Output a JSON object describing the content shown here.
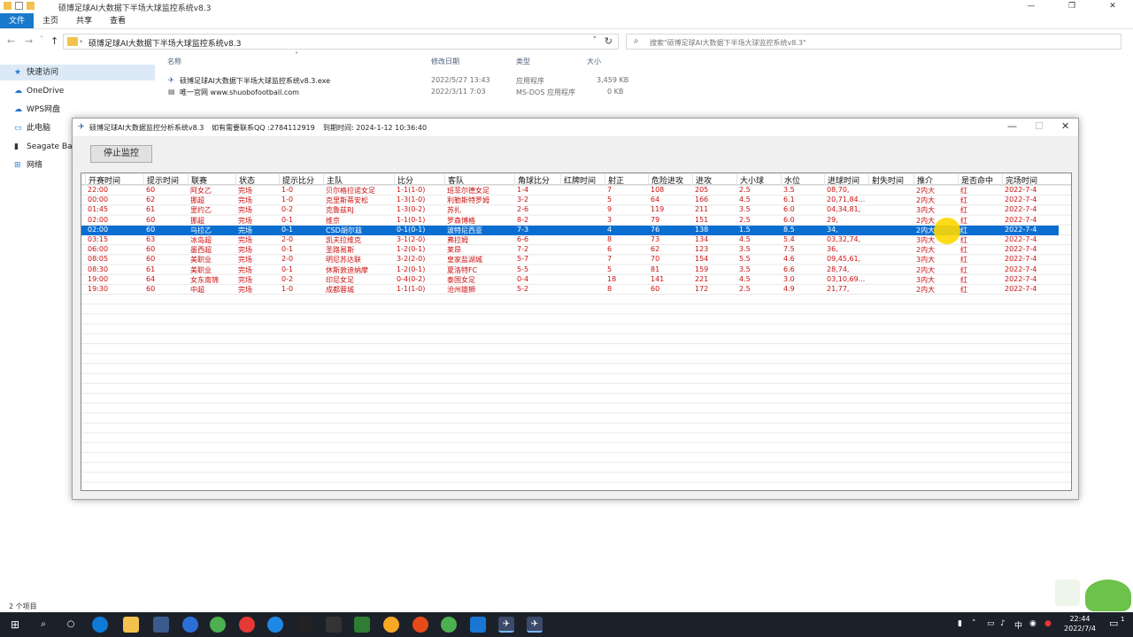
{
  "explorer": {
    "title": "硕博足球AI大数据下半场大球监控系统v8.3",
    "ribbon_tabs": [
      "文件",
      "主页",
      "共享",
      "查看"
    ],
    "breadcrumb": "硕博足球AI大数据下半场大球监控系统v8.3",
    "search_placeholder": "搜索\"硕博足球AI大数据下半场大球监控系统v8.3\"",
    "nav_items": [
      {
        "label": "快速访问",
        "icon": "star-icon"
      },
      {
        "label": "OneDrive",
        "icon": "cloud-icon"
      },
      {
        "label": "WPS网盘",
        "icon": "cloud-icon"
      },
      {
        "label": "此电脑",
        "icon": "computer-icon"
      },
      {
        "label": "Seagate Back",
        "icon": "drive-icon"
      },
      {
        "label": "网络",
        "icon": "network-icon"
      }
    ],
    "columns": [
      "名称",
      "修改日期",
      "类型",
      "大小"
    ],
    "files": [
      {
        "name": "硕博足球AI大数据下半场大球监控系统v8.3.exe",
        "date": "2022/5/27 13:43",
        "type": "应用程序",
        "size": "3,459 KB"
      },
      {
        "name": "唯一官网      www.shuobofootball.com",
        "date": "2022/3/11 7:03",
        "type": "MS-DOS 应用程序",
        "size": "0 KB"
      }
    ],
    "status": "2 个项目"
  },
  "app": {
    "title": "硕博足球AI大数据监控分析系统v8.3",
    "contact": "如有需要联系QQ :2784112919",
    "expire": "到期时间:  2024-1-12 10:36:40",
    "stop_button": "停止监控",
    "columns": [
      "开赛时间",
      "提示时间",
      "联赛",
      "状态",
      "提示比分",
      "主队",
      "比分",
      "客队",
      "角球比分",
      "红牌时间",
      "射正",
      "危险进攻",
      "进攻",
      "大小球",
      "水位",
      "进球时间",
      "射失时间",
      "推介",
      "是否命中",
      "完场时间"
    ],
    "selected_row": 3,
    "rows": [
      [
        "22:00",
        "60",
        "阿女乙",
        "完场",
        "1-0",
        "贝尔格拉诺女足",
        "1-1(1-0)",
        "班菲尔德女足",
        "1-4",
        "",
        "7",
        "108",
        "205",
        "2.5",
        "3.5",
        "08,70,",
        "",
        "2内大",
        "红",
        "2022-7-4"
      ],
      [
        "00:00",
        "62",
        "挪超",
        "完场",
        "1-0",
        "克里斯蒂安松",
        "1-3(1-0)",
        "利勒斯特罗姆",
        "3-2",
        "",
        "5",
        "64",
        "166",
        "4.5",
        "6.1",
        "20,71,84...",
        "",
        "2内大",
        "红",
        "2022-7-4"
      ],
      [
        "01:45",
        "61",
        "里约乙",
        "完场",
        "0-2",
        "克鲁兹RJ",
        "1-3(0-2)",
        "苏扎",
        "2-6",
        "",
        "9",
        "119",
        "211",
        "3.5",
        "6.0",
        "04,34,81,",
        "",
        "3内大",
        "红",
        "2022-7-4"
      ],
      [
        "02:00",
        "60",
        "挪超",
        "完场",
        "0-1",
        "维京",
        "1-1(0-1)",
        "罗森博格",
        "8-2",
        "",
        "3",
        "79",
        "151",
        "2.5",
        "6.0",
        "29,",
        "",
        "2内大",
        "红",
        "2022-7-4"
      ],
      [
        "02:00",
        "60",
        "乌拉乙",
        "完场",
        "0-1",
        "CSD胡尔玆",
        "0-1(0-1)",
        "波特尼西亚",
        "7-3",
        "",
        "4",
        "76",
        "138",
        "1.5",
        "8.5",
        "34,",
        "",
        "2内大",
        "红",
        "2022-7-4"
      ],
      [
        "03:15",
        "63",
        "冰岛超",
        "完场",
        "2-0",
        "凯夫拉维克",
        "3-1(2-0)",
        "弗拉姆",
        "6-6",
        "",
        "8",
        "73",
        "134",
        "4.5",
        "5.4",
        "03,32,74,",
        "",
        "3内大",
        "红",
        "2022-7-4"
      ],
      [
        "06:00",
        "60",
        "墨西超",
        "完场",
        "0-1",
        "圣路易斯",
        "1-2(0-1)",
        "莱昂",
        "7-2",
        "",
        "6",
        "62",
        "123",
        "3.5",
        "7.5",
        "36,",
        "",
        "2内大",
        "红",
        "2022-7-4"
      ],
      [
        "08:05",
        "60",
        "美职业",
        "完场",
        "2-0",
        "明尼苏达联",
        "3-2(2-0)",
        "皇家盐湖城",
        "5-7",
        "",
        "7",
        "70",
        "154",
        "5.5",
        "4.6",
        "09,45,61,",
        "",
        "3内大",
        "红",
        "2022-7-4"
      ],
      [
        "08:30",
        "61",
        "美职业",
        "完场",
        "0-1",
        "休斯敦迪纳摩",
        "1-2(0-1)",
        "夏洛特FC",
        "5-5",
        "",
        "5",
        "81",
        "159",
        "3.5",
        "6.6",
        "28,74,",
        "",
        "2内大",
        "红",
        "2022-7-4"
      ],
      [
        "19:00",
        "64",
        "女东南锦",
        "完场",
        "0-2",
        "印尼女足",
        "0-4(0-2)",
        "泰国女足",
        "0-4",
        "",
        "18",
        "141",
        "221",
        "4.5",
        "3.0",
        "03,10,69...",
        "",
        "3内大",
        "红",
        "2022-7-4"
      ],
      [
        "19:30",
        "60",
        "中超",
        "完场",
        "1-0",
        "成都蓉城",
        "1-1(1-0)",
        "沧州雄狮",
        "5-2",
        "",
        "8",
        "60",
        "172",
        "2.5",
        "4.9",
        "21,77,",
        "",
        "2内大",
        "红",
        "2022-7-4"
      ]
    ]
  },
  "taskbar": {
    "time": "22:44",
    "date": "2022/7/4",
    "ime": "中",
    "notification_count": "1"
  },
  "colors": {
    "selection": "#0a6ed1",
    "row_text": "#cc1111",
    "taskbar": "#1c2029"
  }
}
